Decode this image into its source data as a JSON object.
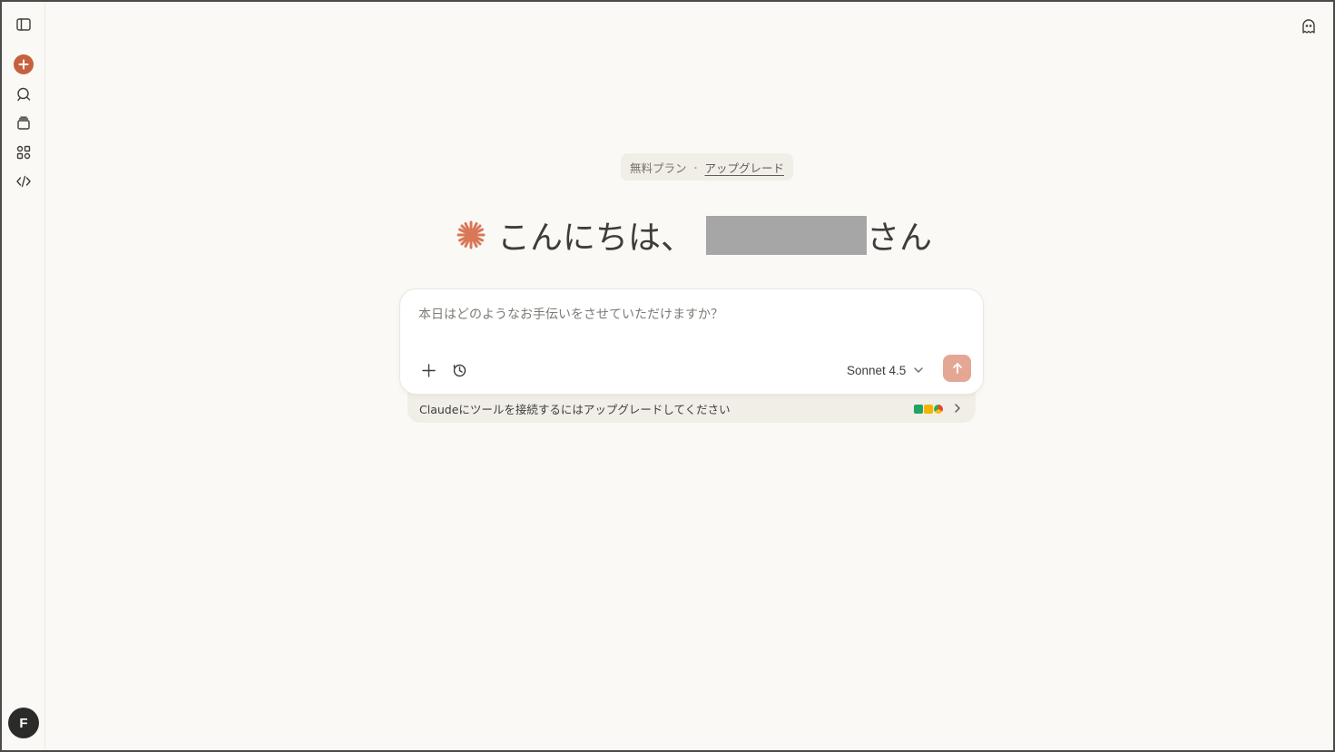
{
  "sidebar": {
    "icons": [
      "sidebar-toggle-icon",
      "new-chat-icon",
      "chats-icon",
      "projects-icon",
      "artifacts-icon",
      "code-icon"
    ],
    "avatar_initial": "F"
  },
  "header": {
    "plan_label": "無料プラン",
    "separator": "・",
    "upgrade_label": "アップグレード"
  },
  "greeting": {
    "prefix": "こんにちは、",
    "suffix": "さん"
  },
  "composer": {
    "placeholder": "本日はどのようなお手伝いをさせていただけますか？",
    "model_label": "Sonnet 4.5"
  },
  "tools_bar": {
    "text": "Claudeにツールを接続するにはアップグレードしてください"
  },
  "colors": {
    "accent": "#c6613f",
    "send_disabled": "#e3a793",
    "background": "#faf9f5"
  }
}
